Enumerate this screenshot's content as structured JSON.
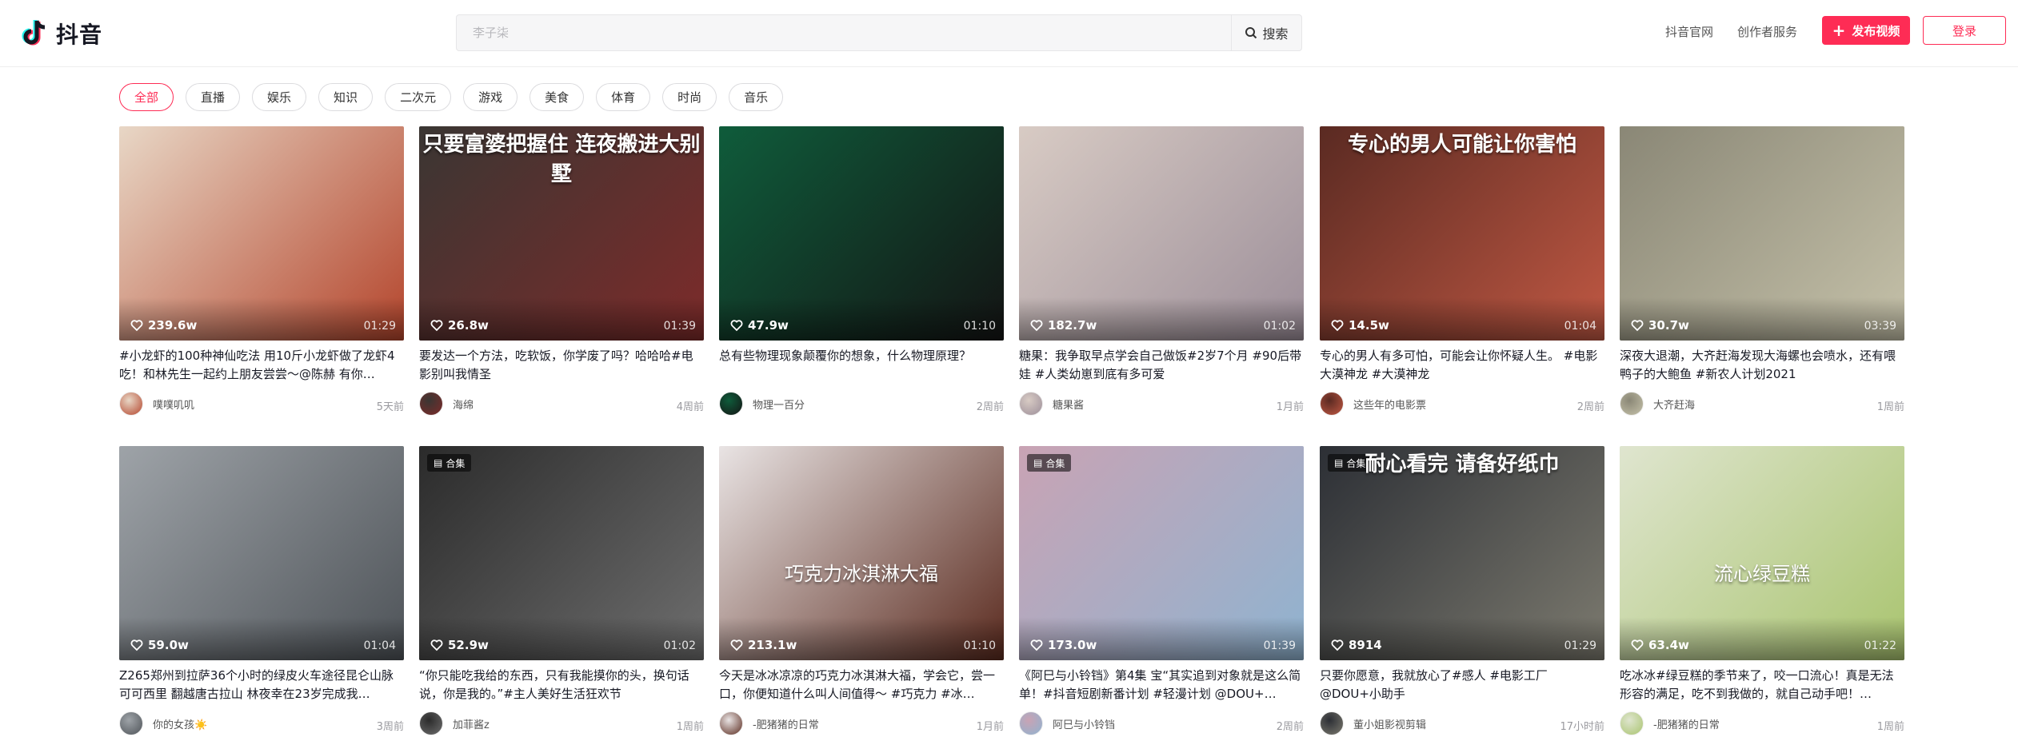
{
  "header": {
    "logo_text": "抖音",
    "search_placeholder": "李子柒",
    "search_button": "搜索",
    "links": [
      "抖音官网",
      "创作者服务"
    ],
    "publish_button": "发布视频",
    "login_button": "登录",
    "accent": "#fe2c55"
  },
  "categories": {
    "active_index": 0,
    "items": [
      "全部",
      "直播",
      "娱乐",
      "知识",
      "二次元",
      "游戏",
      "美食",
      "体育",
      "时尚",
      "音乐"
    ]
  },
  "videos": [
    {
      "likes": "239.6w",
      "duration": "01:29",
      "desc": "#小龙虾的100种神仙吃法 用10斤小龙虾做了龙虾4吃！和林先生一起约上朋友尝尝～@陈赫 有你…",
      "author": "噗噗叽叽",
      "time": "5天前",
      "overlay_top": "",
      "overlay_mid": "",
      "badge": ""
    },
    {
      "likes": "26.8w",
      "duration": "01:39",
      "desc": "要发达一个方法，吃软饭，你学废了吗？哈哈哈#电影别叫我情圣",
      "author": "海绵",
      "time": "4周前",
      "overlay_top": "只要富婆把握住 连夜搬进大别墅",
      "overlay_mid": "",
      "badge": ""
    },
    {
      "likes": "47.9w",
      "duration": "01:10",
      "desc": "总有些物理现象颠覆你的想象，什么物理原理？",
      "author": "物理一百分",
      "time": "2周前",
      "overlay_top": "",
      "overlay_mid": "",
      "badge": ""
    },
    {
      "likes": "182.7w",
      "duration": "01:02",
      "desc": "糖果：我争取早点学会自己做饭#2岁7个月 #90后带娃 #人类幼崽到底有多可爱",
      "author": "糖果酱",
      "time": "1月前",
      "overlay_top": "",
      "overlay_mid": "",
      "badge": ""
    },
    {
      "likes": "14.5w",
      "duration": "01:04",
      "desc": "专心的男人有多可怕，可能会让你怀疑人生。 #电影大漠神龙 #大漠神龙",
      "author": "这些年的电影票",
      "time": "2周前",
      "overlay_top": "专心的男人可能让你害怕",
      "overlay_mid": "",
      "badge": ""
    },
    {
      "likes": "30.7w",
      "duration": "03:39",
      "desc": "深夜大退潮，大齐赶海发现大海螺也会喷水，还有喂鸭子的大鲍鱼 #新农人计划2021",
      "author": "大齐赶海",
      "time": "1周前",
      "overlay_top": "",
      "overlay_mid": "",
      "badge": ""
    },
    {
      "likes": "59.0w",
      "duration": "01:04",
      "desc": "Z265郑州到拉萨36个小时的绿皮火车途径昆仑山脉 可可西里 翻越唐古拉山 林夜幸在23岁完成我…",
      "author": "你的女孩☀️",
      "time": "3周前",
      "overlay_top": "",
      "overlay_mid": "",
      "badge": ""
    },
    {
      "likes": "52.9w",
      "duration": "01:02",
      "desc": "“你只能吃我给的东西，只有我能摸你的头，换句话说，你是我的。”#主人美好生活狂欢节",
      "author": "加菲酱z",
      "time": "1周前",
      "overlay_top": "",
      "overlay_mid": "",
      "badge": "合集"
    },
    {
      "likes": "213.1w",
      "duration": "01:10",
      "desc": "今天是冰冰凉凉的巧克力冰淇淋大福，学会它，尝一口，你便知道什么叫人间值得～ #巧克力 #冰…",
      "author": "-肥猪猪的日常",
      "time": "1月前",
      "overlay_top": "",
      "overlay_mid": "巧克力冰淇淋大福",
      "badge": ""
    },
    {
      "likes": "173.0w",
      "duration": "01:39",
      "desc": "《阿巳与小铃铛》第4集 宝“其实追到对象就是这么简单！#抖音短剧新番计划 #轻漫计划 @DOU+…",
      "author": "阿巳与小铃铛",
      "time": "2周前",
      "overlay_top": "",
      "overlay_mid": "",
      "badge": "合集"
    },
    {
      "likes": "8914",
      "duration": "01:29",
      "desc": "只要你愿意，我就放心了#感人 #电影工厂 @DOU+小助手",
      "author": "董小姐影视剪辑",
      "time": "17小时前",
      "overlay_top": "耐心看完 请备好纸巾",
      "overlay_mid": "",
      "badge": "合集"
    },
    {
      "likes": "63.4w",
      "duration": "01:22",
      "desc": "吃冰冰#绿豆糕的季节来了，咬一口流心！真是无法形容的满足，吃不到我做的，就自己动手吧！…",
      "author": "-肥猪猪的日常",
      "time": "1周前",
      "overlay_top": "",
      "overlay_mid": "流心绿豆糕",
      "badge": ""
    }
  ],
  "thumb_colors": [
    [
      "#e8d7c6",
      "#b4452c"
    ],
    [
      "#3a3633",
      "#7d2b2a"
    ],
    [
      "#0f5c3b",
      "#141414"
    ],
    [
      "#d8cbc4",
      "#9c8e99"
    ],
    [
      "#5a2a22",
      "#c05843"
    ],
    [
      "#8a8776",
      "#c5c1a9"
    ],
    [
      "#9ea3a8",
      "#4e5358"
    ],
    [
      "#2b2b2b",
      "#6e6e6e"
    ],
    [
      "#e9e4e4",
      "#5a2a1e"
    ],
    [
      "#c9a3b4",
      "#8fb3d0"
    ],
    [
      "#2c2f35",
      "#7c7a6f"
    ],
    [
      "#dfe5cf",
      "#a9c46f"
    ]
  ]
}
